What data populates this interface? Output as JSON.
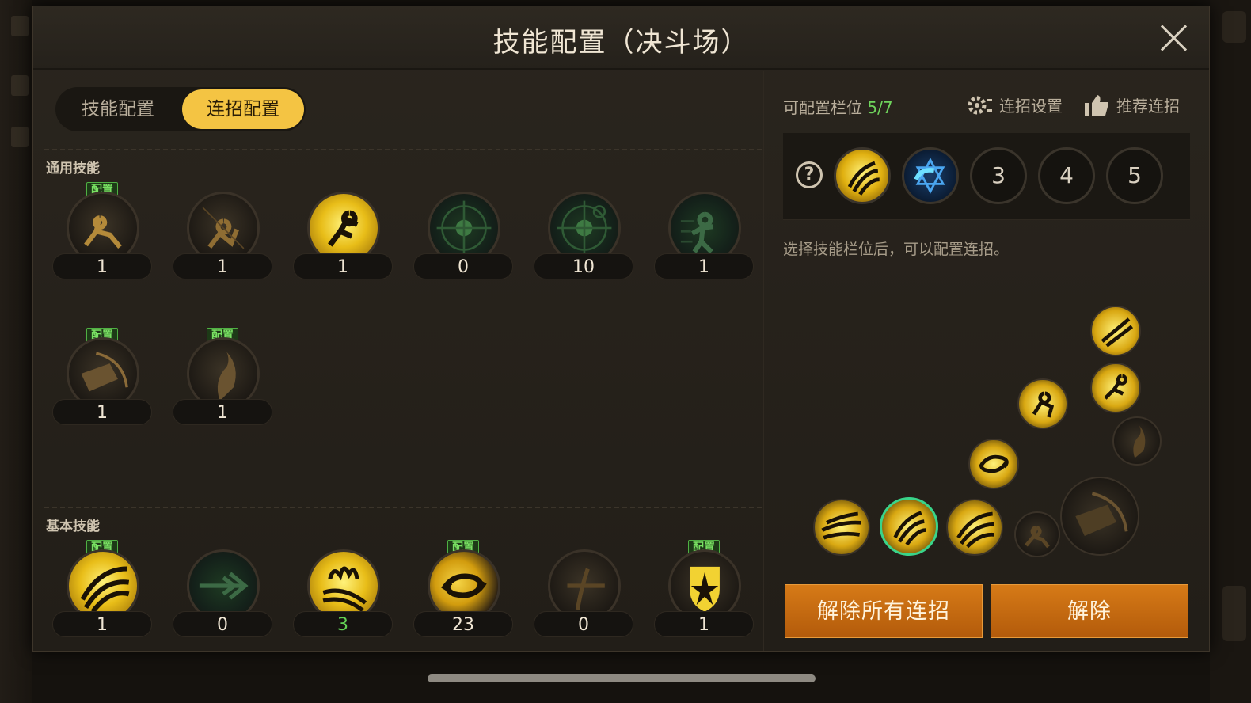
{
  "title": "技能配置（决斗场）",
  "tabs": [
    {
      "label": "技能配置",
      "active": false
    },
    {
      "label": "连招配置",
      "active": true
    }
  ],
  "sections": {
    "general_label": "通用技能",
    "basic_label": "基本技能"
  },
  "badge_text": "配置",
  "general_skills": [
    {
      "icon": "fallen-figure-icon",
      "count": "1",
      "configured": true
    },
    {
      "icon": "crouch-figure-icon",
      "count": "1",
      "configured": false
    },
    {
      "icon": "dash-figure-icon",
      "count": "1",
      "configured": false
    },
    {
      "icon": "target-icon",
      "count": "0",
      "configured": false
    },
    {
      "icon": "target-gear-icon",
      "count": "10",
      "configured": false
    },
    {
      "icon": "figure-blur-icon",
      "count": "1",
      "configured": false
    },
    {
      "icon": "shield-slash-icon",
      "count": "1",
      "configured": true
    },
    {
      "icon": "uppercut-icon",
      "count": "1",
      "configured": true
    }
  ],
  "basic_skills": [
    {
      "icon": "triple-slash-icon",
      "count": "1",
      "configured": true,
      "count_color": "white"
    },
    {
      "icon": "arrow-thrust-icon",
      "count": "0",
      "configured": false,
      "count_color": "white"
    },
    {
      "icon": "flame-slash-icon",
      "count": "3",
      "configured": false,
      "count_color": "green"
    },
    {
      "icon": "whirlwind-icon",
      "count": "23",
      "configured": true,
      "count_color": "white"
    },
    {
      "icon": "crossed-blade-icon",
      "count": "0",
      "configured": false,
      "count_color": "white"
    },
    {
      "icon": "shield-star-icon",
      "count": "1",
      "configured": true,
      "count_color": "white"
    }
  ],
  "right_panel": {
    "slots_label": "可配置栏位",
    "slots_value": "5/7",
    "combo_settings": "连招设置",
    "recommend_combo": "推荐连招",
    "help_icon": "question-icon",
    "combo_slots": [
      {
        "type": "icon",
        "icon": "claw-slash-icon"
      },
      {
        "type": "icon",
        "icon": "blue-star-icon"
      },
      {
        "type": "number",
        "label": "3"
      },
      {
        "type": "number",
        "label": "4"
      },
      {
        "type": "number",
        "label": "5"
      }
    ],
    "hint": "选择技能栏位后，可以配置连招。",
    "buttons": {
      "clear_all": "解除所有连招",
      "clear": "解除"
    }
  },
  "colors": {
    "accent_yellow": "#f4c443",
    "green_value": "#62d054",
    "button_orange": "#c86a10"
  }
}
